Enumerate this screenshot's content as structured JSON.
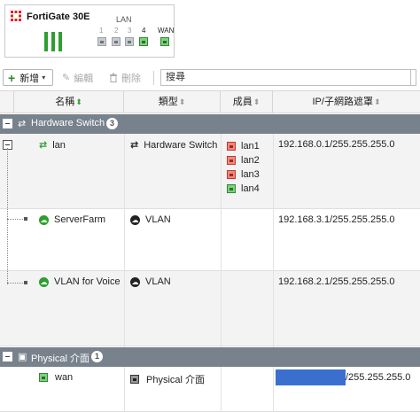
{
  "device": {
    "title": "FortiGate 30E",
    "lan_label": "LAN",
    "wan_label": "WAN",
    "ports": [
      {
        "num": "1",
        "status": "down"
      },
      {
        "num": "2",
        "status": "down"
      },
      {
        "num": "3",
        "status": "down"
      },
      {
        "num": "4",
        "status": "up"
      }
    ],
    "wan_status": "up"
  },
  "toolbar": {
    "create_label": "新增",
    "edit_label": "編輯",
    "delete_label": "刪除",
    "search_placeholder": "搜尋"
  },
  "columns": {
    "name": "名稱",
    "type": "類型",
    "members": "成員",
    "ip": "IP/子網路遮罩"
  },
  "groups": [
    {
      "label": "Hardware Switch",
      "count": "3"
    },
    {
      "label": "Physical 介面",
      "count": "1"
    }
  ],
  "rows": [
    {
      "name": "lan",
      "type": "Hardware Switch",
      "ip": "192.168.0.1/255.255.255.0",
      "members": [
        {
          "label": "lan1",
          "status": "down"
        },
        {
          "label": "lan2",
          "status": "down"
        },
        {
          "label": "lan3",
          "status": "down"
        },
        {
          "label": "lan4",
          "status": "up"
        }
      ]
    },
    {
      "name": "ServerFarm",
      "type": "VLAN",
      "ip": "192.168.3.1/255.255.255.0"
    },
    {
      "name": "VLAN for Voice",
      "type": "VLAN",
      "ip": "192.168.2.1/255.255.255.0"
    },
    {
      "name": "wan",
      "type": "Physical 介面",
      "ip": "/255.255.255.0"
    }
  ],
  "colors": {
    "accent_green": "#2e9e2e",
    "group_header": "#78828c",
    "port_down": "#f08a80",
    "port_up": "#7fd07f",
    "redaction": "#3a6fd0"
  }
}
